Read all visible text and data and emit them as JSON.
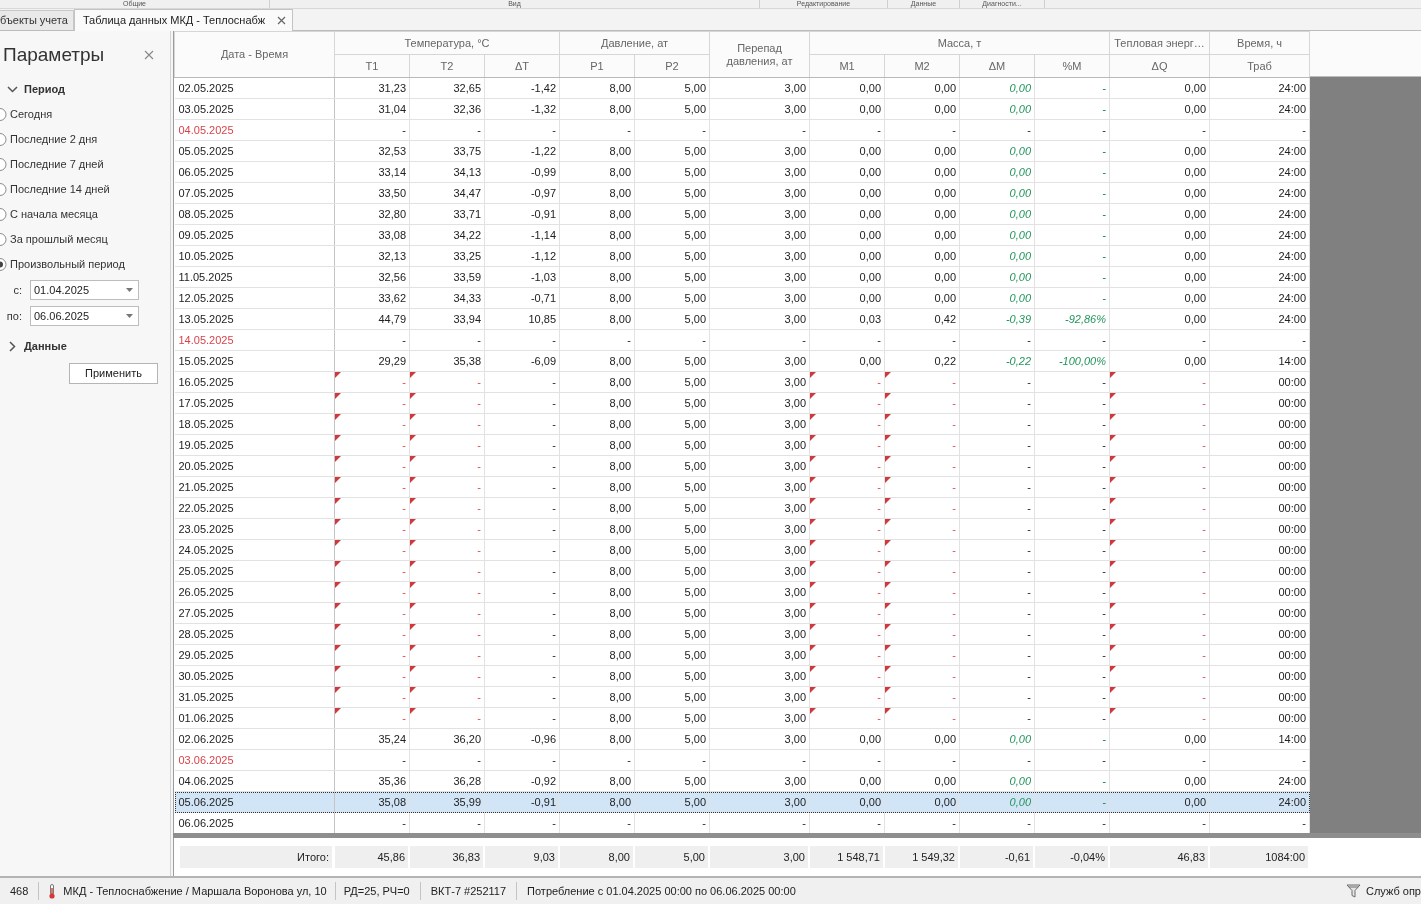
{
  "ribbon_groups": [
    "Общие",
    "Вид",
    "Редактирование",
    "Данные",
    "Диагности..."
  ],
  "tabs": [
    {
      "label": "бъекты учета",
      "selected": false
    },
    {
      "label": "Таблица данных МКД - Теплоснабж",
      "selected": true
    }
  ],
  "parameters": {
    "title": "Параметры",
    "sections": [
      {
        "label": "Период",
        "expanded": true,
        "options": [
          {
            "label": "Сегодня",
            "selected": false
          },
          {
            "label": "Последние 2 дня",
            "selected": false
          },
          {
            "label": "Последние 7 дней",
            "selected": false
          },
          {
            "label": "Последние 14 дней",
            "selected": false
          },
          {
            "label": "С начала месяца",
            "selected": false
          },
          {
            "label": "За прошлый месяц",
            "selected": false
          },
          {
            "label": "Произвольный период",
            "selected": true
          }
        ],
        "fields": [
          {
            "label": "с:",
            "value": "01.04.2025"
          },
          {
            "label": "по:",
            "value": "06.06.2025"
          }
        ]
      },
      {
        "label": "Данные",
        "expanded": false
      }
    ],
    "apply_button": "Применить"
  },
  "table": {
    "date_column": {
      "label": "Дата - Время"
    },
    "columns": [
      {
        "label": "Температура, °C",
        "children": [
          {
            "label": "T1",
            "highlight": false
          },
          {
            "label": "T2",
            "highlight": false
          },
          {
            "label": "ΔT",
            "highlight": false
          }
        ]
      },
      {
        "label": "Давление, ат",
        "children": [
          {
            "label": "P1",
            "highlight": false
          },
          {
            "label": "P2",
            "highlight": false
          }
        ]
      },
      {
        "label": "Перепад давления, ат",
        "highlight": false
      },
      {
        "label": "Масса, т",
        "children": [
          {
            "label": "M1",
            "highlight": false
          },
          {
            "label": "M2",
            "highlight": false
          },
          {
            "label": "ΔM",
            "highlight": true
          },
          {
            "label": "%M",
            "highlight": true
          }
        ]
      },
      {
        "label": "Тепловая энерг…",
        "children": [
          {
            "label": "ΔQ",
            "highlight": false
          }
        ]
      },
      {
        "label": "Время, ч",
        "children": [
          {
            "label": "Траб",
            "highlight": false
          }
        ]
      }
    ],
    "rows": [
      {
        "date": "02.05.2025",
        "kind": "data",
        "selected": false,
        "values": [
          "31,23",
          "32,65",
          "-1,42",
          "8,00",
          "5,00",
          "3,00",
          "0,00",
          "0,00",
          "0,00",
          "-",
          "0,00",
          "24:00"
        ],
        "flagged": [
          false,
          false,
          false,
          false,
          false,
          false,
          false,
          false,
          false,
          false,
          false,
          false
        ]
      },
      {
        "date": "03.05.2025",
        "kind": "data",
        "selected": false,
        "values": [
          "31,04",
          "32,36",
          "-1,32",
          "8,00",
          "5,00",
          "3,00",
          "0,00",
          "0,00",
          "0,00",
          "-",
          "0,00",
          "24:00"
        ],
        "flagged": [
          false,
          false,
          false,
          false,
          false,
          false,
          false,
          false,
          false,
          false,
          false,
          false
        ]
      },
      {
        "date": "04.05.2025",
        "kind": "missing",
        "selected": false,
        "values": [
          "-",
          "-",
          "-",
          "-",
          "-",
          "-",
          "-",
          "-",
          "-",
          "-",
          "-",
          "-"
        ],
        "flagged": [
          false,
          false,
          false,
          false,
          false,
          false,
          false,
          false,
          false,
          false,
          false,
          false
        ]
      },
      {
        "date": "05.05.2025",
        "kind": "data",
        "selected": false,
        "values": [
          "32,53",
          "33,75",
          "-1,22",
          "8,00",
          "5,00",
          "3,00",
          "0,00",
          "0,00",
          "0,00",
          "-",
          "0,00",
          "24:00"
        ],
        "flagged": [
          false,
          false,
          false,
          false,
          false,
          false,
          false,
          false,
          false,
          false,
          false,
          false
        ]
      },
      {
        "date": "06.05.2025",
        "kind": "data",
        "selected": false,
        "values": [
          "33,14",
          "34,13",
          "-0,99",
          "8,00",
          "5,00",
          "3,00",
          "0,00",
          "0,00",
          "0,00",
          "-",
          "0,00",
          "24:00"
        ],
        "flagged": [
          false,
          false,
          false,
          false,
          false,
          false,
          false,
          false,
          false,
          false,
          false,
          false
        ]
      },
      {
        "date": "07.05.2025",
        "kind": "data",
        "selected": false,
        "values": [
          "33,50",
          "34,47",
          "-0,97",
          "8,00",
          "5,00",
          "3,00",
          "0,00",
          "0,00",
          "0,00",
          "-",
          "0,00",
          "24:00"
        ],
        "flagged": [
          false,
          false,
          false,
          false,
          false,
          false,
          false,
          false,
          false,
          false,
          false,
          false
        ]
      },
      {
        "date": "08.05.2025",
        "kind": "data",
        "selected": false,
        "values": [
          "32,80",
          "33,71",
          "-0,91",
          "8,00",
          "5,00",
          "3,00",
          "0,00",
          "0,00",
          "0,00",
          "-",
          "0,00",
          "24:00"
        ],
        "flagged": [
          false,
          false,
          false,
          false,
          false,
          false,
          false,
          false,
          false,
          false,
          false,
          false
        ]
      },
      {
        "date": "09.05.2025",
        "kind": "data",
        "selected": false,
        "values": [
          "33,08",
          "34,22",
          "-1,14",
          "8,00",
          "5,00",
          "3,00",
          "0,00",
          "0,00",
          "0,00",
          "-",
          "0,00",
          "24:00"
        ],
        "flagged": [
          false,
          false,
          false,
          false,
          false,
          false,
          false,
          false,
          false,
          false,
          false,
          false
        ]
      },
      {
        "date": "10.05.2025",
        "kind": "data",
        "selected": false,
        "values": [
          "32,13",
          "33,25",
          "-1,12",
          "8,00",
          "5,00",
          "3,00",
          "0,00",
          "0,00",
          "0,00",
          "-",
          "0,00",
          "24:00"
        ],
        "flagged": [
          false,
          false,
          false,
          false,
          false,
          false,
          false,
          false,
          false,
          false,
          false,
          false
        ]
      },
      {
        "date": "11.05.2025",
        "kind": "data",
        "selected": false,
        "values": [
          "32,56",
          "33,59",
          "-1,03",
          "8,00",
          "5,00",
          "3,00",
          "0,00",
          "0,00",
          "0,00",
          "-",
          "0,00",
          "24:00"
        ],
        "flagged": [
          false,
          false,
          false,
          false,
          false,
          false,
          false,
          false,
          false,
          false,
          false,
          false
        ]
      },
      {
        "date": "12.05.2025",
        "kind": "data",
        "selected": false,
        "values": [
          "33,62",
          "34,33",
          "-0,71",
          "8,00",
          "5,00",
          "3,00",
          "0,00",
          "0,00",
          "0,00",
          "-",
          "0,00",
          "24:00"
        ],
        "flagged": [
          false,
          false,
          false,
          false,
          false,
          false,
          false,
          false,
          false,
          false,
          false,
          false
        ]
      },
      {
        "date": "13.05.2025",
        "kind": "data",
        "selected": false,
        "values": [
          "44,79",
          "33,94",
          "10,85",
          "8,00",
          "5,00",
          "3,00",
          "0,03",
          "0,42",
          "-0,39",
          "-92,86%",
          "0,00",
          "24:00"
        ],
        "flagged": [
          false,
          false,
          false,
          false,
          false,
          false,
          false,
          false,
          false,
          false,
          false,
          false
        ]
      },
      {
        "date": "14.05.2025",
        "kind": "missing",
        "selected": false,
        "values": [
          "-",
          "-",
          "-",
          "-",
          "-",
          "-",
          "-",
          "-",
          "-",
          "-",
          "-",
          "-"
        ],
        "flagged": [
          false,
          false,
          false,
          false,
          false,
          false,
          false,
          false,
          false,
          false,
          false,
          false
        ]
      },
      {
        "date": "15.05.2025",
        "kind": "data",
        "selected": false,
        "values": [
          "29,29",
          "35,38",
          "-6,09",
          "8,00",
          "5,00",
          "3,00",
          "0,00",
          "0,22",
          "-0,22",
          "-100,00%",
          "0,00",
          "14:00"
        ],
        "flagged": [
          false,
          false,
          false,
          false,
          false,
          false,
          false,
          false,
          false,
          false,
          false,
          false
        ]
      },
      {
        "date": "16.05.2025",
        "kind": "incomplete",
        "selected": false,
        "values": [
          "-",
          "-",
          "-",
          "8,00",
          "5,00",
          "3,00",
          "-",
          "-",
          "-",
          "-",
          "-",
          "00:00"
        ],
        "flagged": [
          true,
          true,
          false,
          false,
          false,
          false,
          true,
          true,
          false,
          false,
          true,
          false
        ]
      },
      {
        "date": "17.05.2025",
        "kind": "incomplete",
        "selected": false,
        "values": [
          "-",
          "-",
          "-",
          "8,00",
          "5,00",
          "3,00",
          "-",
          "-",
          "-",
          "-",
          "-",
          "00:00"
        ],
        "flagged": [
          true,
          true,
          false,
          false,
          false,
          false,
          true,
          true,
          false,
          false,
          true,
          false
        ]
      },
      {
        "date": "18.05.2025",
        "kind": "incomplete",
        "selected": false,
        "values": [
          "-",
          "-",
          "-",
          "8,00",
          "5,00",
          "3,00",
          "-",
          "-",
          "-",
          "-",
          "-",
          "00:00"
        ],
        "flagged": [
          true,
          true,
          false,
          false,
          false,
          false,
          true,
          true,
          false,
          false,
          true,
          false
        ]
      },
      {
        "date": "19.05.2025",
        "kind": "incomplete",
        "selected": false,
        "values": [
          "-",
          "-",
          "-",
          "8,00",
          "5,00",
          "3,00",
          "-",
          "-",
          "-",
          "-",
          "-",
          "00:00"
        ],
        "flagged": [
          true,
          true,
          false,
          false,
          false,
          false,
          true,
          true,
          false,
          false,
          true,
          false
        ]
      },
      {
        "date": "20.05.2025",
        "kind": "incomplete",
        "selected": false,
        "values": [
          "-",
          "-",
          "-",
          "8,00",
          "5,00",
          "3,00",
          "-",
          "-",
          "-",
          "-",
          "-",
          "00:00"
        ],
        "flagged": [
          true,
          true,
          false,
          false,
          false,
          false,
          true,
          true,
          false,
          false,
          true,
          false
        ]
      },
      {
        "date": "21.05.2025",
        "kind": "incomplete",
        "selected": false,
        "values": [
          "-",
          "-",
          "-",
          "8,00",
          "5,00",
          "3,00",
          "-",
          "-",
          "-",
          "-",
          "-",
          "00:00"
        ],
        "flagged": [
          true,
          true,
          false,
          false,
          false,
          false,
          true,
          true,
          false,
          false,
          true,
          false
        ]
      },
      {
        "date": "22.05.2025",
        "kind": "incomplete",
        "selected": false,
        "values": [
          "-",
          "-",
          "-",
          "8,00",
          "5,00",
          "3,00",
          "-",
          "-",
          "-",
          "-",
          "-",
          "00:00"
        ],
        "flagged": [
          true,
          true,
          false,
          false,
          false,
          false,
          true,
          true,
          false,
          false,
          true,
          false
        ]
      },
      {
        "date": "23.05.2025",
        "kind": "incomplete",
        "selected": false,
        "values": [
          "-",
          "-",
          "-",
          "8,00",
          "5,00",
          "3,00",
          "-",
          "-",
          "-",
          "-",
          "-",
          "00:00"
        ],
        "flagged": [
          true,
          true,
          false,
          false,
          false,
          false,
          true,
          true,
          false,
          false,
          true,
          false
        ]
      },
      {
        "date": "24.05.2025",
        "kind": "incomplete",
        "selected": false,
        "values": [
          "-",
          "-",
          "-",
          "8,00",
          "5,00",
          "3,00",
          "-",
          "-",
          "-",
          "-",
          "-",
          "00:00"
        ],
        "flagged": [
          true,
          true,
          false,
          false,
          false,
          false,
          true,
          true,
          false,
          false,
          true,
          false
        ]
      },
      {
        "date": "25.05.2025",
        "kind": "incomplete",
        "selected": false,
        "values": [
          "-",
          "-",
          "-",
          "8,00",
          "5,00",
          "3,00",
          "-",
          "-",
          "-",
          "-",
          "-",
          "00:00"
        ],
        "flagged": [
          true,
          true,
          false,
          false,
          false,
          false,
          true,
          true,
          false,
          false,
          true,
          false
        ]
      },
      {
        "date": "26.05.2025",
        "kind": "incomplete",
        "selected": false,
        "values": [
          "-",
          "-",
          "-",
          "8,00",
          "5,00",
          "3,00",
          "-",
          "-",
          "-",
          "-",
          "-",
          "00:00"
        ],
        "flagged": [
          true,
          true,
          false,
          false,
          false,
          false,
          true,
          true,
          false,
          false,
          true,
          false
        ]
      },
      {
        "date": "27.05.2025",
        "kind": "incomplete",
        "selected": false,
        "values": [
          "-",
          "-",
          "-",
          "8,00",
          "5,00",
          "3,00",
          "-",
          "-",
          "-",
          "-",
          "-",
          "00:00"
        ],
        "flagged": [
          true,
          true,
          false,
          false,
          false,
          false,
          true,
          true,
          false,
          false,
          true,
          false
        ]
      },
      {
        "date": "28.05.2025",
        "kind": "incomplete",
        "selected": false,
        "values": [
          "-",
          "-",
          "-",
          "8,00",
          "5,00",
          "3,00",
          "-",
          "-",
          "-",
          "-",
          "-",
          "00:00"
        ],
        "flagged": [
          true,
          true,
          false,
          false,
          false,
          false,
          true,
          true,
          false,
          false,
          true,
          false
        ]
      },
      {
        "date": "29.05.2025",
        "kind": "incomplete",
        "selected": false,
        "values": [
          "-",
          "-",
          "-",
          "8,00",
          "5,00",
          "3,00",
          "-",
          "-",
          "-",
          "-",
          "-",
          "00:00"
        ],
        "flagged": [
          true,
          true,
          false,
          false,
          false,
          false,
          true,
          true,
          false,
          false,
          true,
          false
        ]
      },
      {
        "date": "30.05.2025",
        "kind": "incomplete",
        "selected": false,
        "values": [
          "-",
          "-",
          "-",
          "8,00",
          "5,00",
          "3,00",
          "-",
          "-",
          "-",
          "-",
          "-",
          "00:00"
        ],
        "flagged": [
          true,
          true,
          false,
          false,
          false,
          false,
          true,
          true,
          false,
          false,
          true,
          false
        ]
      },
      {
        "date": "31.05.2025",
        "kind": "incomplete",
        "selected": false,
        "values": [
          "-",
          "-",
          "-",
          "8,00",
          "5,00",
          "3,00",
          "-",
          "-",
          "-",
          "-",
          "-",
          "00:00"
        ],
        "flagged": [
          true,
          true,
          false,
          false,
          false,
          false,
          true,
          true,
          false,
          false,
          true,
          false
        ]
      },
      {
        "date": "01.06.2025",
        "kind": "incomplete",
        "selected": false,
        "values": [
          "-",
          "-",
          "-",
          "8,00",
          "5,00",
          "3,00",
          "-",
          "-",
          "-",
          "-",
          "-",
          "00:00"
        ],
        "flagged": [
          true,
          true,
          false,
          false,
          false,
          false,
          true,
          true,
          false,
          false,
          true,
          false
        ]
      },
      {
        "date": "02.06.2025",
        "kind": "data",
        "selected": false,
        "values": [
          "35,24",
          "36,20",
          "-0,96",
          "8,00",
          "5,00",
          "3,00",
          "0,00",
          "0,00",
          "0,00",
          "-",
          "0,00",
          "14:00"
        ],
        "flagged": [
          false,
          false,
          false,
          false,
          false,
          false,
          false,
          false,
          false,
          false,
          false,
          false
        ]
      },
      {
        "date": "03.06.2025",
        "kind": "missing",
        "selected": false,
        "values": [
          "-",
          "-",
          "-",
          "-",
          "-",
          "-",
          "-",
          "-",
          "-",
          "-",
          "-",
          "-"
        ],
        "flagged": [
          false,
          false,
          false,
          false,
          false,
          false,
          false,
          false,
          false,
          false,
          false,
          false
        ]
      },
      {
        "date": "04.06.2025",
        "kind": "data",
        "selected": false,
        "values": [
          "35,36",
          "36,28",
          "-0,92",
          "8,00",
          "5,00",
          "3,00",
          "0,00",
          "0,00",
          "0,00",
          "-",
          "0,00",
          "24:00"
        ],
        "flagged": [
          false,
          false,
          false,
          false,
          false,
          false,
          false,
          false,
          false,
          false,
          false,
          false
        ]
      },
      {
        "date": "05.06.2025",
        "kind": "data",
        "selected": true,
        "values": [
          "35,08",
          "35,99",
          "-0,91",
          "8,00",
          "5,00",
          "3,00",
          "0,00",
          "0,00",
          "0,00",
          "-",
          "0,00",
          "24:00"
        ],
        "flagged": [
          false,
          false,
          false,
          false,
          false,
          false,
          false,
          false,
          false,
          false,
          false,
          false
        ]
      },
      {
        "date": "06.06.2025",
        "kind": "incomplete",
        "selected": false,
        "values": [
          "-",
          "-",
          "-",
          "-",
          "-",
          "-",
          "-",
          "-",
          "-",
          "-",
          "-",
          "-"
        ],
        "flagged": [
          false,
          false,
          false,
          false,
          false,
          false,
          false,
          false,
          false,
          false,
          false,
          false
        ]
      }
    ]
  },
  "totals": {
    "label": "Итого:",
    "values": [
      "45,86",
      "36,83",
      "9,03",
      "8,00",
      "5,00",
      "3,00",
      "1 548,71",
      "1 549,32",
      "-0,61",
      "-0,04%",
      "46,83",
      "1084:00"
    ]
  },
  "status_bar": {
    "items": [
      {
        "text": "468",
        "kind": "plain"
      },
      {
        "text": "МКД - Теплоснабжение / Маршала Воронова ул, 10",
        "kind": "object"
      },
      {
        "text": "РД=25, РЧ=0",
        "kind": "plain"
      },
      {
        "text": "ВКТ-7 #252117",
        "kind": "plain"
      },
      {
        "text": "Потребление с 01.04.2025 00:00 по 06.06.2025 00:00",
        "kind": "plain"
      },
      {
        "text": "Служб опр",
        "kind": "service"
      }
    ]
  }
}
